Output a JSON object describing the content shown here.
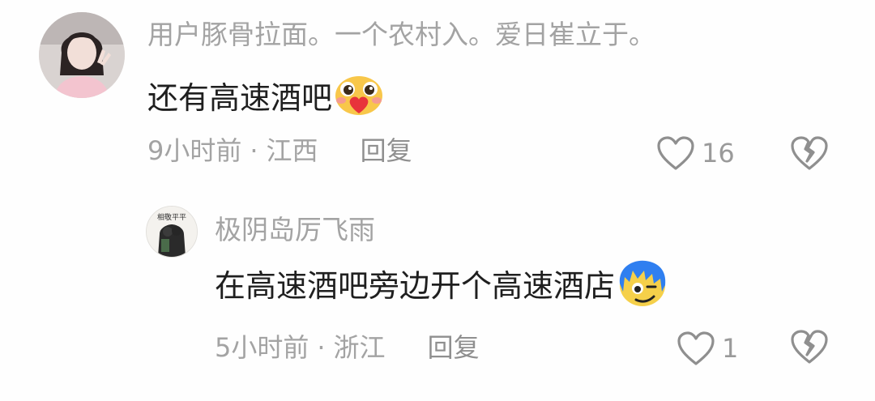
{
  "comments": [
    {
      "username": "用户豚骨拉面。一个农村入。爱日崔立于。",
      "text": "还有高速酒吧",
      "emoji_icon": "blushing-heart-emoji",
      "time": "9小时前",
      "separator": "·",
      "location": "江西",
      "reply_label": "回复",
      "like_count": "16"
    },
    {
      "username": "极阴岛厉飞雨",
      "avatar_text": "相敬平平",
      "text": "在高速酒吧旁边开个高速酒店",
      "emoji_icon": "blue-hair-smirk-emoji",
      "time": "5小时前",
      "separator": "·",
      "location": "浙江",
      "reply_label": "回复",
      "like_count": "1"
    }
  ]
}
